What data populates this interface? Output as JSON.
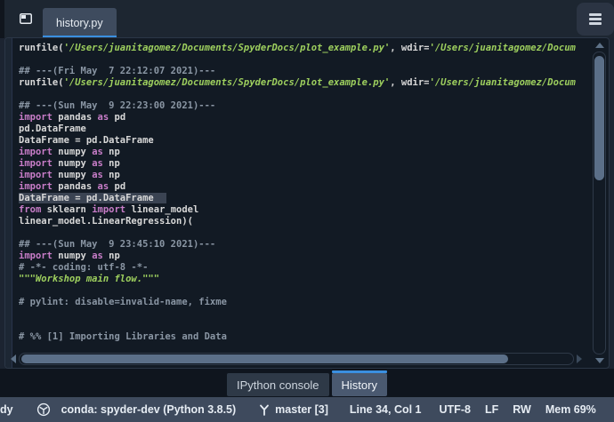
{
  "header": {
    "tab_label": "history.py"
  },
  "editor": {
    "lines": [
      {
        "segments": [
          {
            "text": "runfile(",
            "style": "plain"
          },
          {
            "text": "'/Users/juanitagomez/Documents/SpyderDocs/plot_example.py'",
            "style": "string"
          },
          {
            "text": ", wdir=",
            "style": "plain"
          },
          {
            "text": "'/Users/juanitagomez/Docum",
            "style": "string"
          }
        ]
      },
      {
        "segments": []
      },
      {
        "segments": [
          {
            "text": "## ---(Fri May  7 22:12:07 2021)---",
            "style": "comment"
          }
        ]
      },
      {
        "segments": [
          {
            "text": "runfile(",
            "style": "plain"
          },
          {
            "text": "'/Users/juanitagomez/Documents/SpyderDocs/plot_example.py'",
            "style": "string"
          },
          {
            "text": ", wdir=",
            "style": "plain"
          },
          {
            "text": "'/Users/juanitagomez/Docum",
            "style": "string"
          }
        ]
      },
      {
        "segments": []
      },
      {
        "segments": [
          {
            "text": "## ---(Sun May  9 22:23:00 2021)---",
            "style": "comment"
          }
        ]
      },
      {
        "segments": [
          {
            "text": "import",
            "style": "keyword"
          },
          {
            "text": " pandas ",
            "style": "plain"
          },
          {
            "text": "as",
            "style": "keyword"
          },
          {
            "text": " pd",
            "style": "plain"
          }
        ]
      },
      {
        "segments": [
          {
            "text": "pd.DataFrame",
            "style": "plain"
          }
        ]
      },
      {
        "segments": [
          {
            "text": "DataFrame = pd.DataFrame",
            "style": "plain"
          }
        ]
      },
      {
        "segments": [
          {
            "text": "import",
            "style": "keyword"
          },
          {
            "text": " numpy ",
            "style": "plain"
          },
          {
            "text": "as",
            "style": "keyword"
          },
          {
            "text": " np",
            "style": "plain"
          }
        ]
      },
      {
        "segments": [
          {
            "text": "import",
            "style": "keyword"
          },
          {
            "text": " numpy ",
            "style": "plain"
          },
          {
            "text": "as",
            "style": "keyword"
          },
          {
            "text": " np",
            "style": "plain"
          }
        ]
      },
      {
        "segments": [
          {
            "text": "import",
            "style": "keyword"
          },
          {
            "text": " numpy ",
            "style": "plain"
          },
          {
            "text": "as",
            "style": "keyword"
          },
          {
            "text": " np",
            "style": "plain"
          }
        ]
      },
      {
        "segments": [
          {
            "text": "import",
            "style": "keyword"
          },
          {
            "text": " pandas ",
            "style": "plain"
          },
          {
            "text": "as",
            "style": "keyword"
          },
          {
            "text": " pd",
            "style": "plain"
          }
        ]
      },
      {
        "highlight": true,
        "segments": [
          {
            "text": "DataFrame = pd.DataFrame",
            "style": "plain"
          }
        ]
      },
      {
        "segments": [
          {
            "text": "from",
            "style": "keyword"
          },
          {
            "text": " sklearn ",
            "style": "plain"
          },
          {
            "text": "import",
            "style": "keyword"
          },
          {
            "text": " linear_model",
            "style": "plain"
          }
        ]
      },
      {
        "segments": [
          {
            "text": "linear_model.LinearRegression)(",
            "style": "plain"
          }
        ]
      },
      {
        "segments": []
      },
      {
        "segments": [
          {
            "text": "## ---(Sun May  9 23:45:10 2021)---",
            "style": "comment"
          }
        ]
      },
      {
        "segments": [
          {
            "text": "import",
            "style": "keyword"
          },
          {
            "text": " numpy ",
            "style": "plain"
          },
          {
            "text": "as",
            "style": "keyword"
          },
          {
            "text": " np",
            "style": "plain"
          }
        ]
      },
      {
        "segments": [
          {
            "text": "# -*- coding: utf-8 -*-",
            "style": "comment"
          }
        ]
      },
      {
        "segments": [
          {
            "text": "\"\"\"Workshop main flow.\"\"\"",
            "style": "string"
          }
        ]
      },
      {
        "segments": []
      },
      {
        "segments": [
          {
            "text": "# pylint: disable=invalid-name, fixme",
            "style": "comment"
          }
        ]
      },
      {
        "segments": []
      },
      {
        "segments": []
      },
      {
        "segments": [
          {
            "text": "# %% [1] Importing Libraries and Data",
            "style": "comment"
          }
        ]
      }
    ]
  },
  "panel_tabs": [
    {
      "label": "IPython console",
      "active": false
    },
    {
      "label": "History",
      "active": true
    }
  ],
  "statusbar": {
    "left_partial": "dy",
    "conda": "conda: spyder-dev (Python 3.8.5)",
    "git_branch": "master [3]",
    "cursor": "Line 34, Col 1",
    "encoding": "UTF-8",
    "eol": "LF",
    "permissions": "RW",
    "memory": "Mem 69%"
  },
  "icons": {
    "pane": "pane-icon",
    "menu": "hamburger-menu-icon",
    "conda": "package-cube-icon",
    "git": "git-branch-icon"
  },
  "colors": {
    "accent_blue": "#3a8fe0",
    "keyword": "#c87dc8",
    "string": "#9ed05e",
    "comment": "#8a96a4",
    "code_bg": "#121a24",
    "statusbar_bg": "#3e4a5d",
    "highlight_line": "#3a4352",
    "scrollbar_thumb": "#5b6f88"
  }
}
